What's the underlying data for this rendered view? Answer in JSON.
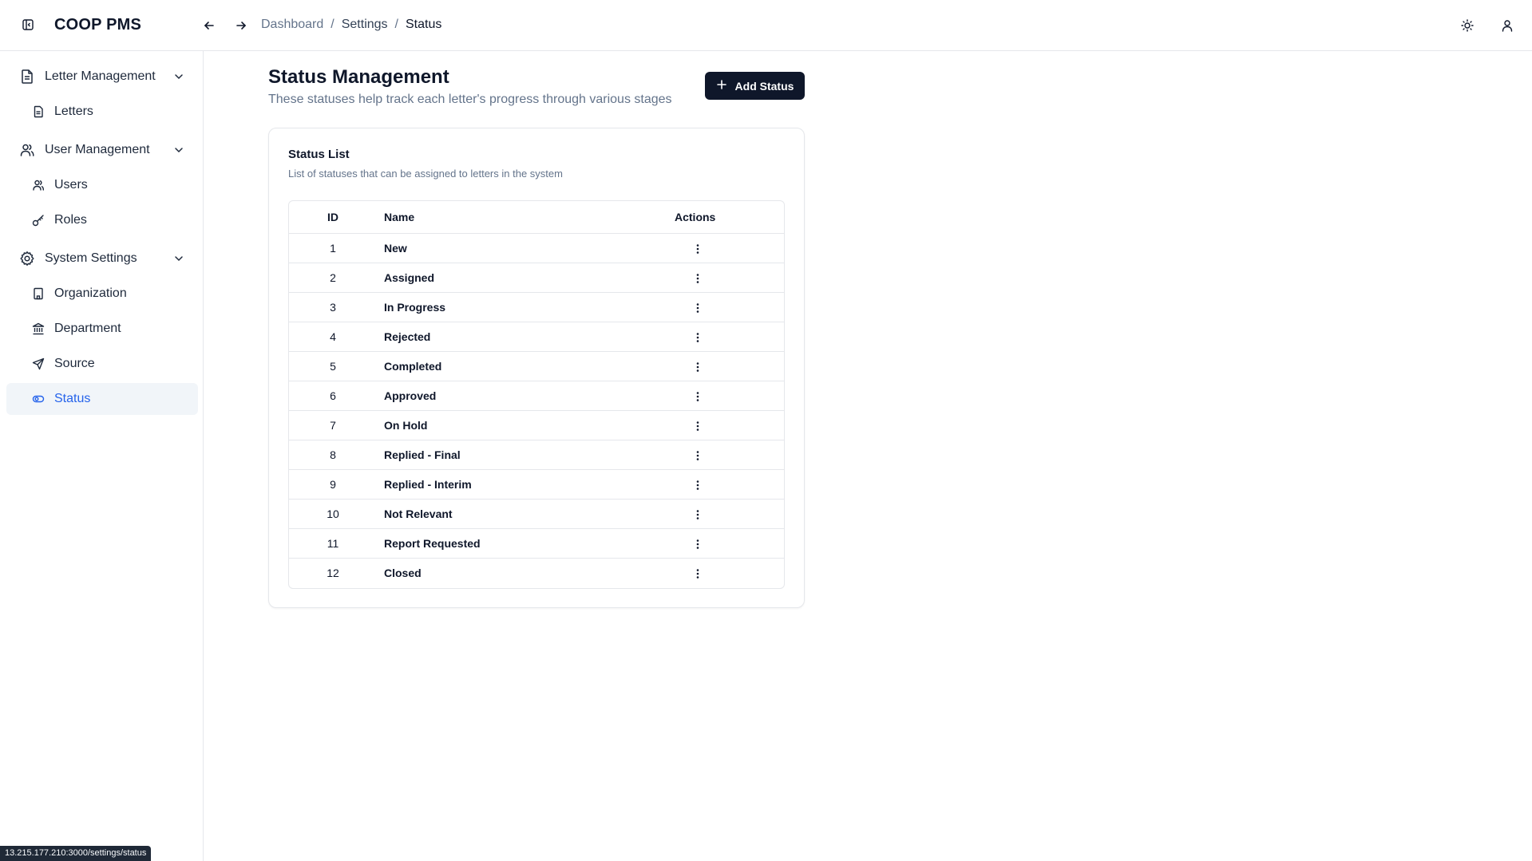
{
  "app": {
    "name": "COOP PMS"
  },
  "breadcrumb": [
    "Dashboard",
    "Settings",
    "Status"
  ],
  "sidebar": {
    "groups": [
      {
        "label": "Letter Management",
        "icon": "file-text-icon",
        "items": [
          {
            "label": "Letters",
            "icon": "file-icon"
          }
        ]
      },
      {
        "label": "User Management",
        "icon": "users-icon",
        "items": [
          {
            "label": "Users",
            "icon": "users-icon"
          },
          {
            "label": "Roles",
            "icon": "key-icon"
          }
        ]
      },
      {
        "label": "System Settings",
        "icon": "gear-icon",
        "items": [
          {
            "label": "Organization",
            "icon": "building-icon"
          },
          {
            "label": "Department",
            "icon": "landmark-icon"
          },
          {
            "label": "Source",
            "icon": "send-icon"
          },
          {
            "label": "Status",
            "icon": "toggle-icon",
            "active": true
          }
        ]
      }
    ]
  },
  "main": {
    "title": "Status Management",
    "subtitle": "These statuses help track each letter's progress through various stages",
    "add_button": "Add Status",
    "card": {
      "title": "Status List",
      "description": "List of statuses that can be assigned to letters in the system",
      "columns": [
        "ID",
        "Name",
        "Actions"
      ],
      "rows": [
        {
          "id": "1",
          "name": "New"
        },
        {
          "id": "2",
          "name": "Assigned"
        },
        {
          "id": "3",
          "name": "In Progress"
        },
        {
          "id": "4",
          "name": "Rejected"
        },
        {
          "id": "5",
          "name": "Completed"
        },
        {
          "id": "6",
          "name": "Approved"
        },
        {
          "id": "7",
          "name": "On Hold"
        },
        {
          "id": "8",
          "name": "Replied - Final"
        },
        {
          "id": "9",
          "name": "Replied - Interim"
        },
        {
          "id": "10",
          "name": "Not Relevant"
        },
        {
          "id": "11",
          "name": "Report Requested"
        },
        {
          "id": "12",
          "name": "Closed"
        }
      ]
    }
  },
  "status_bar": {
    "url": "13.215.177.210:3000/settings/status"
  },
  "colors": {
    "primary": "#0f172a",
    "active": "#2563eb",
    "muted": "#64748b",
    "border": "#e5e7eb"
  }
}
